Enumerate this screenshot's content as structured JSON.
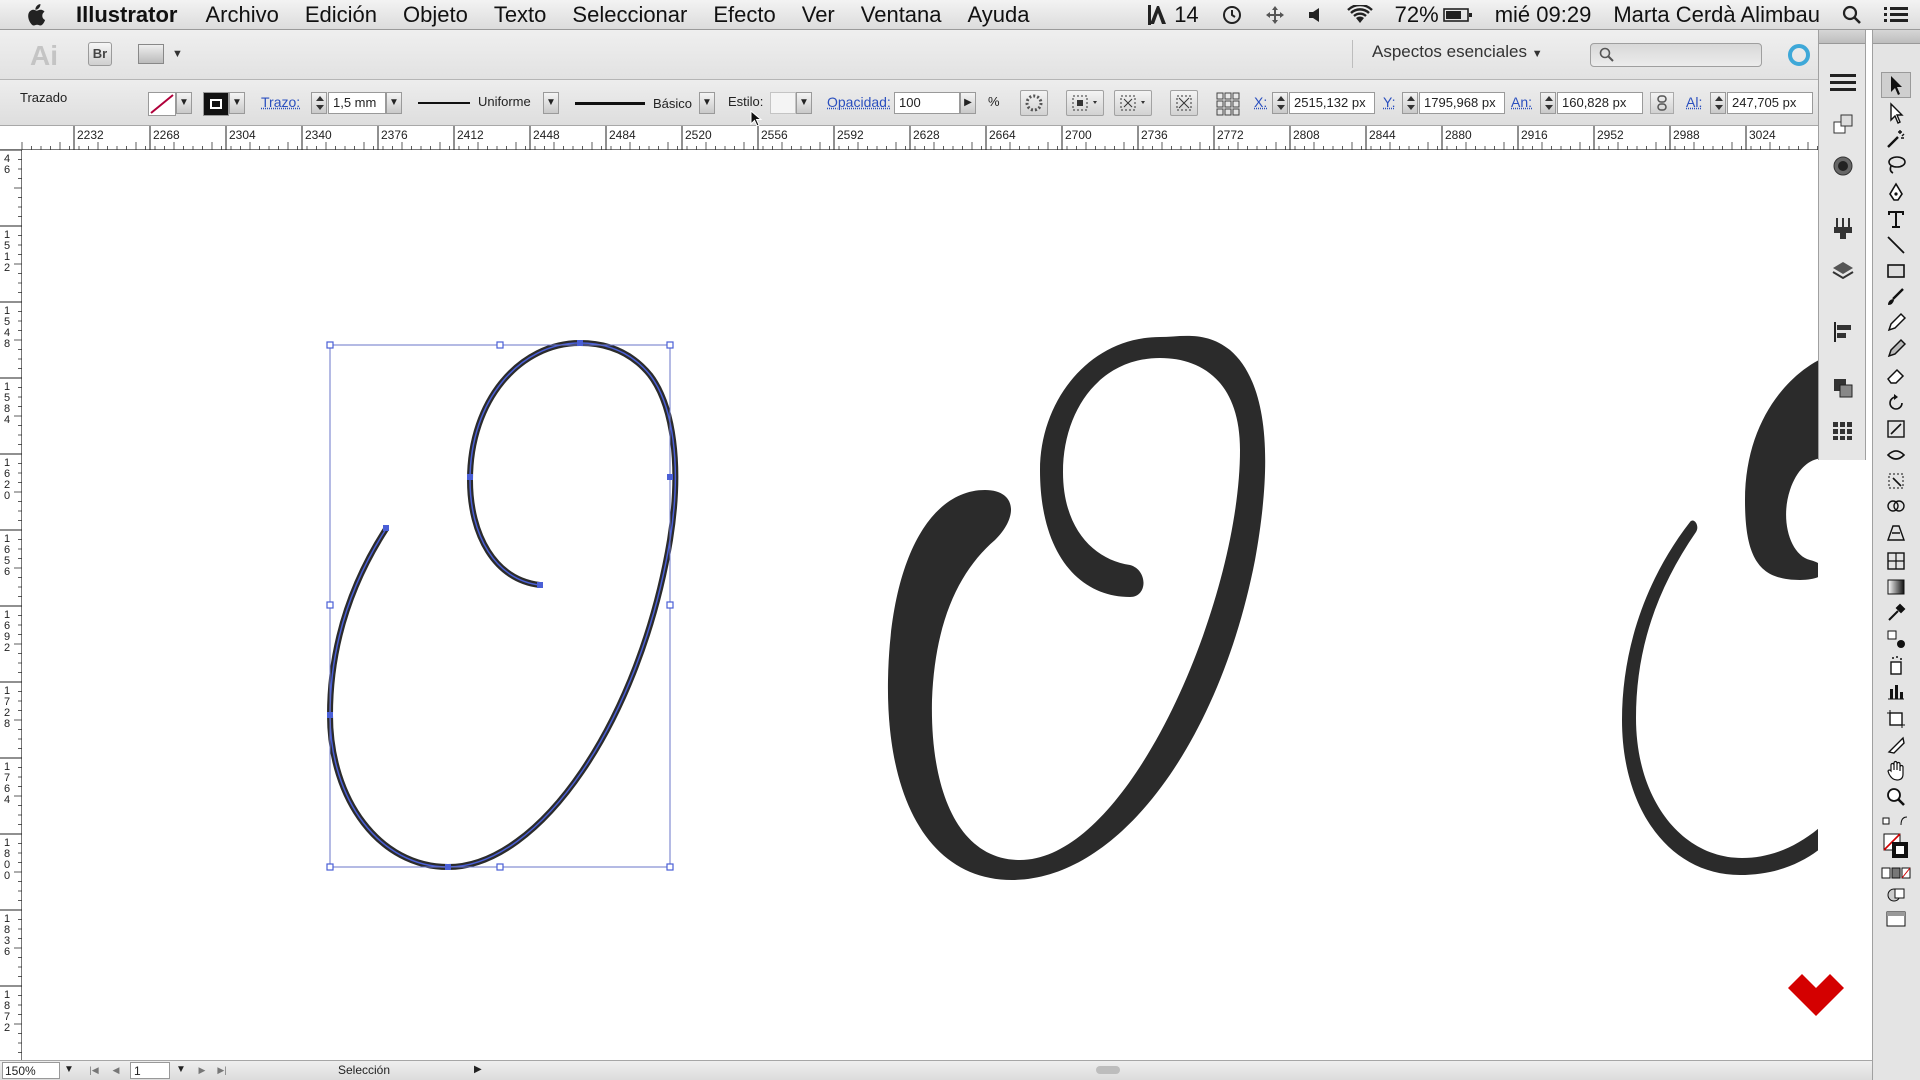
{
  "menubar": {
    "app_name": "Illustrator",
    "items": [
      "Archivo",
      "Edición",
      "Objeto",
      "Texto",
      "Seleccionar",
      "Efecto",
      "Ver",
      "Ventana",
      "Ayuda"
    ],
    "adobe_badge": "14",
    "battery": "72%",
    "clock": "mié 09:29",
    "user": "Marta Cerdà Alimbau"
  },
  "appbar": {
    "logo": "Ai",
    "bridge_label": "Br",
    "workspace": "Aspectos esenciales"
  },
  "controlbar": {
    "object_type": "Trazado",
    "stroke_label": "Trazo:",
    "stroke_value": "1,5 mm",
    "profile_label": "Uniforme",
    "brush_label": "Básico",
    "style_label": "Estilo:",
    "opacity_label": "Opacidad:",
    "opacity_value": "100",
    "opacity_unit": "%",
    "x_label": "X:",
    "x_value": "2515,132 px",
    "y_label": "Y:",
    "y_value": "1795,968 px",
    "w_label": "An:",
    "w_value": "160,828 px",
    "h_label": "Al:",
    "h_value": "247,705 px"
  },
  "ruler_top": [
    "2232",
    "2268",
    "2304",
    "2340",
    "2376",
    "2412",
    "2448",
    "2484",
    "2520",
    "2556",
    "2592",
    "2628",
    "2664",
    "2700",
    "2736",
    "2772",
    "2808",
    "2844",
    "2880",
    "2916",
    "2952",
    "2988",
    "3024"
  ],
  "ruler_left": [
    "4\n6",
    "1\n5\n1\n2",
    "1\n5\n4\n8",
    "1\n5\n8\n4",
    "1\n6\n2\n0",
    "1\n6\n5\n6",
    "1\n6\n9\n2",
    "1\n7\n2\n8",
    "1\n7\n6\n4",
    "1\n8\n0\n0",
    "1\n8\n3\n6",
    "1\n8\n7\n2"
  ],
  "statusbar": {
    "zoom": "150%",
    "artboard": "1",
    "tool_status": "Selección"
  },
  "colors": {
    "glyph": "#2b2b2b",
    "selection": "#4a5fd6",
    "watermark": "#d40000"
  }
}
